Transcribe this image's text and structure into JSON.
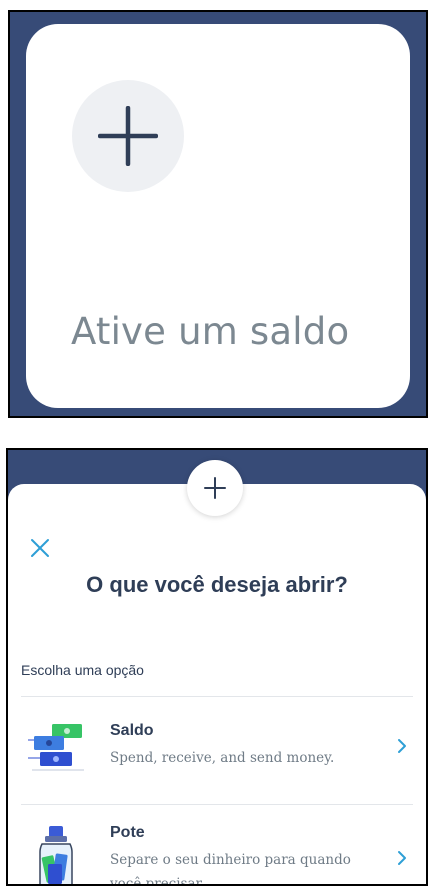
{
  "panel1": {
    "card_label": "Ative um saldo",
    "plus_icon": "plus-icon"
  },
  "panel2": {
    "title": "O que você deseja abrir?",
    "section_label": "Escolha uma opção",
    "options": [
      {
        "title": "Saldo",
        "description": "Spend, receive, and send money.",
        "icon": "money-bills-icon"
      },
      {
        "title": "Pote",
        "description": "Separe o seu dinheiro para quando você precisar.",
        "icon": "jar-icon"
      }
    ]
  },
  "colors": {
    "navy_background": "#374b77",
    "title_text": "#2f3e57",
    "accent_blue": "#2e9fd6",
    "muted_text": "#7c8891"
  }
}
